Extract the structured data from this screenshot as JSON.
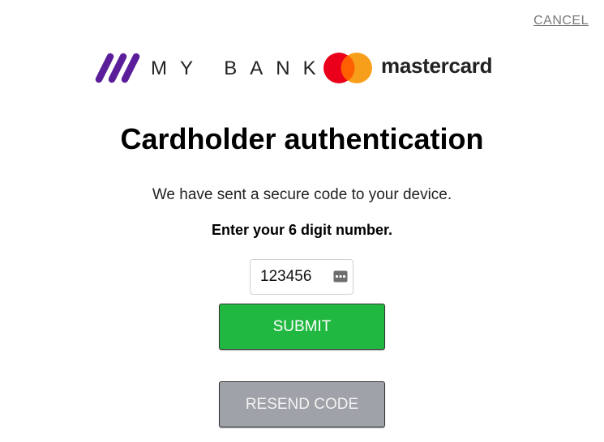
{
  "header": {
    "cancel_label": "CANCEL"
  },
  "branding": {
    "bank_name": "MY BANK",
    "bank_color": "#5b1e9a",
    "card_network": "mastercard",
    "mc_red": "#eb001b",
    "mc_orange": "#f79e1b"
  },
  "main": {
    "title": "Cardholder authentication",
    "message": "We have sent a secure code to your device.",
    "instruction": "Enter your 6 digit number.",
    "code_value": "123456",
    "submit_label": "SUBMIT",
    "resend_label": "RESEND CODE"
  },
  "colors": {
    "submit": "#21b842",
    "resend": "#9fa2a8"
  }
}
